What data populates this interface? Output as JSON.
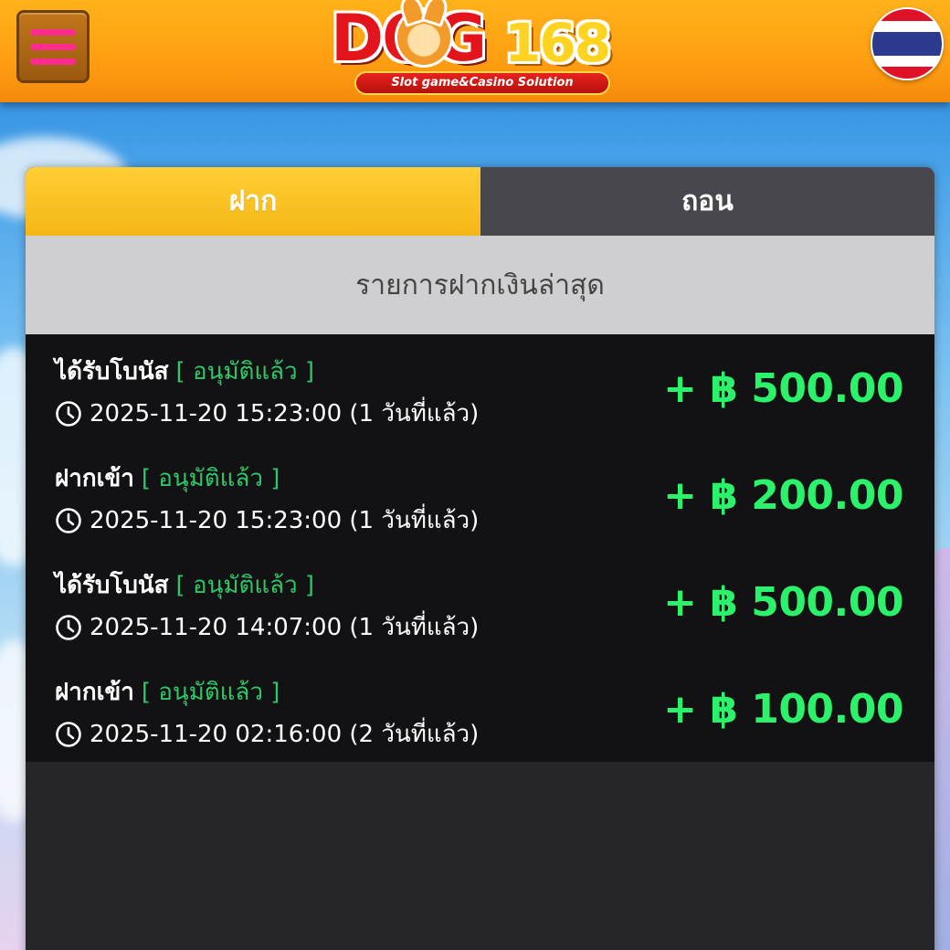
{
  "header": {
    "logo_main": "DOG",
    "logo_number": "168",
    "logo_tagline": "Slot game&Casino Solution"
  },
  "tabs": [
    {
      "label": "ฝาก",
      "active": true
    },
    {
      "label": "ถอน",
      "active": false
    }
  ],
  "section_title": "รายการฝากเงินล่าสุด",
  "transactions": [
    {
      "type": "ได้รับโบนัส",
      "status": "[ อนุมัติแล้ว ]",
      "datetime": "2025-11-20 15:23:00 (1 วันที่แล้ว)",
      "amount": "+ ฿ 500.00"
    },
    {
      "type": "ฝากเข้า",
      "status": "[ อนุมัติแล้ว ]",
      "datetime": "2025-11-20 15:23:00 (1 วันที่แล้ว)",
      "amount": "+ ฿ 200.00"
    },
    {
      "type": "ได้รับโบนัส",
      "status": "[ อนุมัติแล้ว ]",
      "datetime": "2025-11-20 14:07:00 (1 วันที่แล้ว)",
      "amount": "+ ฿ 500.00"
    },
    {
      "type": "ฝากเข้า",
      "status": "[ อนุมัติแล้ว ]",
      "datetime": "2025-11-20 02:16:00 (2 วันที่แล้ว)",
      "amount": "+ ฿ 100.00"
    }
  ],
  "colors": {
    "header": "#ff9e12",
    "active_tab": "#f5b716",
    "inactive_tab": "#47474d",
    "status": "#2cc766",
    "amount": "#2bf26a",
    "menu_bars": "#ff2b8e"
  },
  "icons": [
    "hamburger-menu-icon",
    "thailand-flag-icon",
    "clock-icon"
  ]
}
